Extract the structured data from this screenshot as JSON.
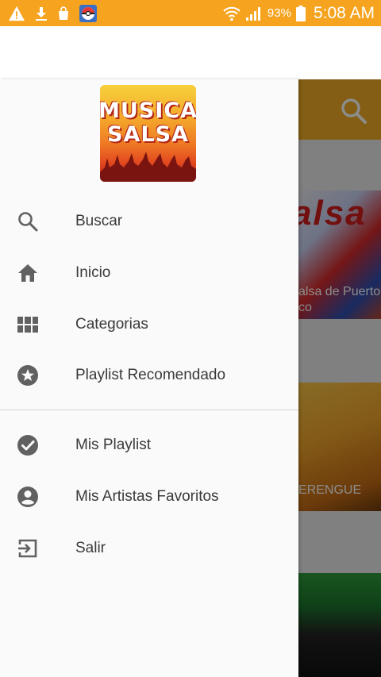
{
  "status_bar": {
    "battery_percent": "93%",
    "time": "5:08 AM",
    "background_color": "#f6a41f",
    "icons": [
      "warning-icon",
      "download-icon",
      "bag-icon",
      "pokeball-icon",
      "wifi-icon",
      "signal-icon",
      "battery-icon"
    ]
  },
  "drawer": {
    "logo": {
      "line1": "MUSICA",
      "line2": "SALSA"
    },
    "menu": [
      {
        "label": "Buscar",
        "icon": "search-icon"
      },
      {
        "label": "Inicio",
        "icon": "home-icon"
      },
      {
        "label": "Categorias",
        "icon": "grid-icon"
      },
      {
        "label": "Playlist Recomendado",
        "icon": "star-circle-icon"
      },
      {
        "label": "Mis Playlist",
        "icon": "check-circle-icon"
      },
      {
        "label": "Mis Artistas Favoritos",
        "icon": "account-circle-icon"
      },
      {
        "label": "Salir",
        "icon": "exit-icon"
      }
    ]
  },
  "background": {
    "accent_color": "#f1ac25",
    "cards": [
      {
        "title_line1": "alsa de Puerto",
        "title_line2": "co"
      },
      {
        "title": "ERENGUE"
      },
      {
        "title": ""
      }
    ]
  }
}
